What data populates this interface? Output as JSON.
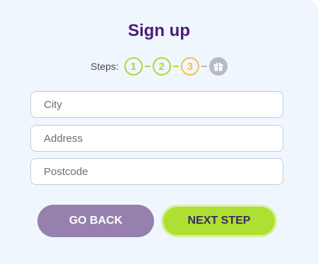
{
  "form": {
    "title": "Sign up",
    "steps_label": "Steps:",
    "steps": [
      {
        "label": "1",
        "state": "done"
      },
      {
        "label": "2",
        "state": "done"
      },
      {
        "label": "3",
        "state": "current"
      }
    ],
    "final_step_icon": "gift-icon",
    "fields": {
      "city_placeholder": "City",
      "address_placeholder": "Address",
      "postcode_placeholder": "Postcode"
    },
    "buttons": {
      "back_label": "GO BACK",
      "next_label": "NEXT STEP"
    }
  },
  "colors": {
    "background": "#f0f6fd",
    "title": "#4b1c7b",
    "step_done": "#a8dc3a",
    "step_current": "#f4c24a",
    "step_pending": "#b8bcc2",
    "back_button": "#9580ae",
    "next_button": "#aee034"
  }
}
